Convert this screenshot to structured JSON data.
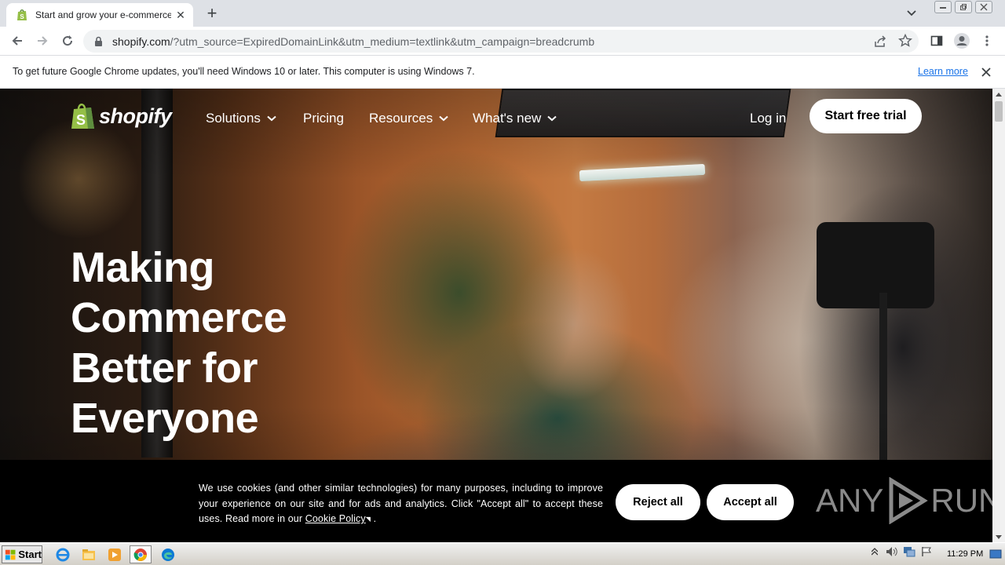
{
  "browser": {
    "tab_title": "Start and grow your e-commerce bu",
    "url_host": "shopify.com",
    "url_rest": "/?utm_source=ExpiredDomainLink&utm_medium=textlink&utm_campaign=breadcrumb"
  },
  "infobar": {
    "message": "To get future Google Chrome updates, you'll need Windows 10 or later. This computer is using Windows 7.",
    "link": "Learn more"
  },
  "site": {
    "logo_text": "shopify",
    "nav": {
      "solutions": "Solutions",
      "pricing": "Pricing",
      "resources": "Resources",
      "whats_new": "What's new",
      "login": "Log in",
      "cta": "Start free trial"
    },
    "headline": [
      "Making",
      "Commerce",
      "Better for",
      "Everyone"
    ]
  },
  "cookie": {
    "text": "We use cookies (and other similar technologies) for many purposes, including to improve your experience on our site and for ads and analytics. Click \"Accept all\" to accept these uses. Read more in our",
    "link": "Cookie Policy",
    "trailing": ".",
    "reject": "Reject all",
    "accept": "Accept all"
  },
  "watermark": "ANY RUN",
  "watermark_parts": {
    "left": "ANY",
    "right": "RUN"
  },
  "taskbar": {
    "start": "Start",
    "clock": "11:29 PM"
  },
  "colors": {
    "shopify_green": "#95bf47",
    "chrome_tabstrip": "#dee1e6",
    "link_blue": "#1a73e8"
  }
}
